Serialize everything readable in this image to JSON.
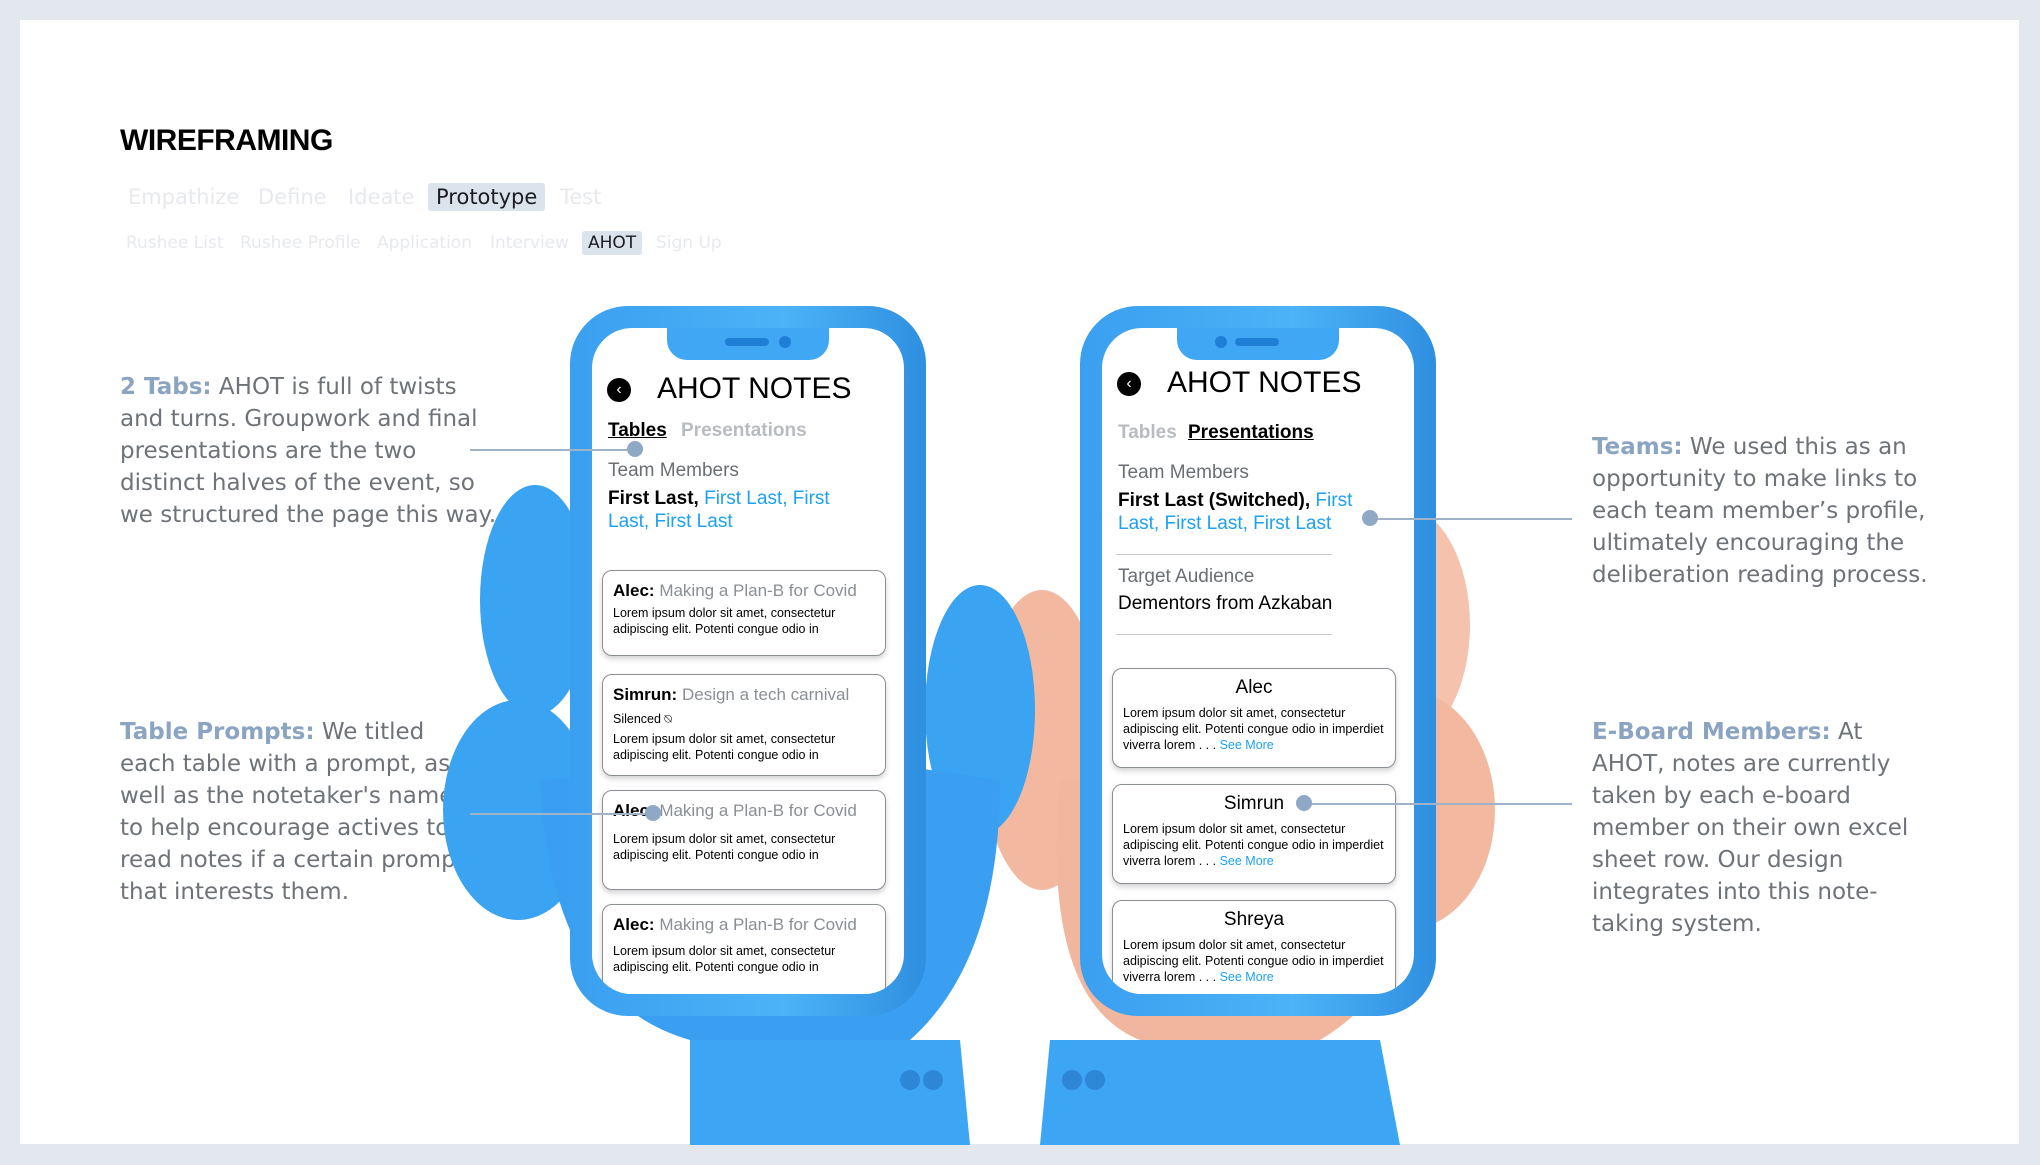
{
  "page": {
    "title": "WIREFRAMING"
  },
  "stages": [
    "Empathize",
    "Define",
    "Ideate",
    "Prototype",
    "Test"
  ],
  "stage_active": "Prototype",
  "screens": [
    "Rushee List",
    "Rushee Profile",
    "Application",
    "Interview",
    "AHOT",
    "Sign Up"
  ],
  "screen_active": "AHOT",
  "notes": {
    "tabs": {
      "key": "2 Tabs:",
      "text": "AHOT is full of twists and turns. Groupwork and final presentations are the two distinct halves of the event, so we structured the page this way."
    },
    "prompts": {
      "key": "Table Prompts:",
      "text": "We titled each table with a prompt, as well as the notetaker's name, to help encourage actives to read notes if a certain prompt that interests them."
    },
    "teams": {
      "key": "Teams:",
      "text": "We used this as an opportunity to make links to each team member’s profile, ultimately encouraging the deliberation reading process."
    },
    "eboard": {
      "key": "E-Board Members:",
      "text": "At AHOT, notes are currently taken by each e-board member on their own excel sheet row. Our design integrates into this note-taking system."
    }
  },
  "phone_left": {
    "header": "AHOT NOTES",
    "tab_tables": "Tables",
    "tab_presentations": "Presentations",
    "team_label": "Team Members",
    "member_first": "First Last,",
    "member_links": "First Last, First Last, First Last",
    "cards": [
      {
        "name": "Alec:",
        "prompt": "Making a Plan-B for Covid",
        "extra": "",
        "body": "Lorem ipsum dolor sit amet, consectetur adipiscing elit. Potenti congue odio in"
      },
      {
        "name": "Simrun:",
        "prompt": "Design a tech carnival",
        "extra": "Silenced ⍉",
        "body": "Lorem ipsum dolor sit amet, consectetur adipiscing elit. Potenti congue odio in"
      },
      {
        "name": "Alec:",
        "prompt": "Making a Plan-B for Covid",
        "extra": "",
        "body": "Lorem ipsum dolor sit amet, consectetur adipiscing elit. Potenti congue odio in"
      },
      {
        "name": "Alec:",
        "prompt": "Making a Plan-B for Covid",
        "extra": "",
        "body": "Lorem ipsum dolor sit amet, consectetur adipiscing elit. Potenti congue odio in"
      }
    ]
  },
  "phone_right": {
    "header": "AHOT NOTES",
    "tab_tables": "Tables",
    "tab_presentations": "Presentations",
    "team_label": "Team Members",
    "member_first": "First Last (Switched),",
    "member_links": "First Last, First Last, First Last",
    "audience_label": "Target Audience",
    "audience_value": "Dementors from Azkaban",
    "cards": [
      {
        "name": "Alec",
        "body": "Lorem ipsum dolor sit amet, consectetur adipiscing elit. Potenti congue odio in imperdiet viverra lorem . . .",
        "more": "See More"
      },
      {
        "name": "Simrun",
        "body": "Lorem ipsum dolor sit amet, consectetur adipiscing elit. Potenti congue odio in imperdiet viverra lorem . . .",
        "more": "See More"
      },
      {
        "name": "Shreya",
        "body": "Lorem ipsum dolor sit amet, consectetur adipiscing elit. Potenti congue odio in imperdiet viverra lorem . . .",
        "more": "See More"
      }
    ]
  }
}
